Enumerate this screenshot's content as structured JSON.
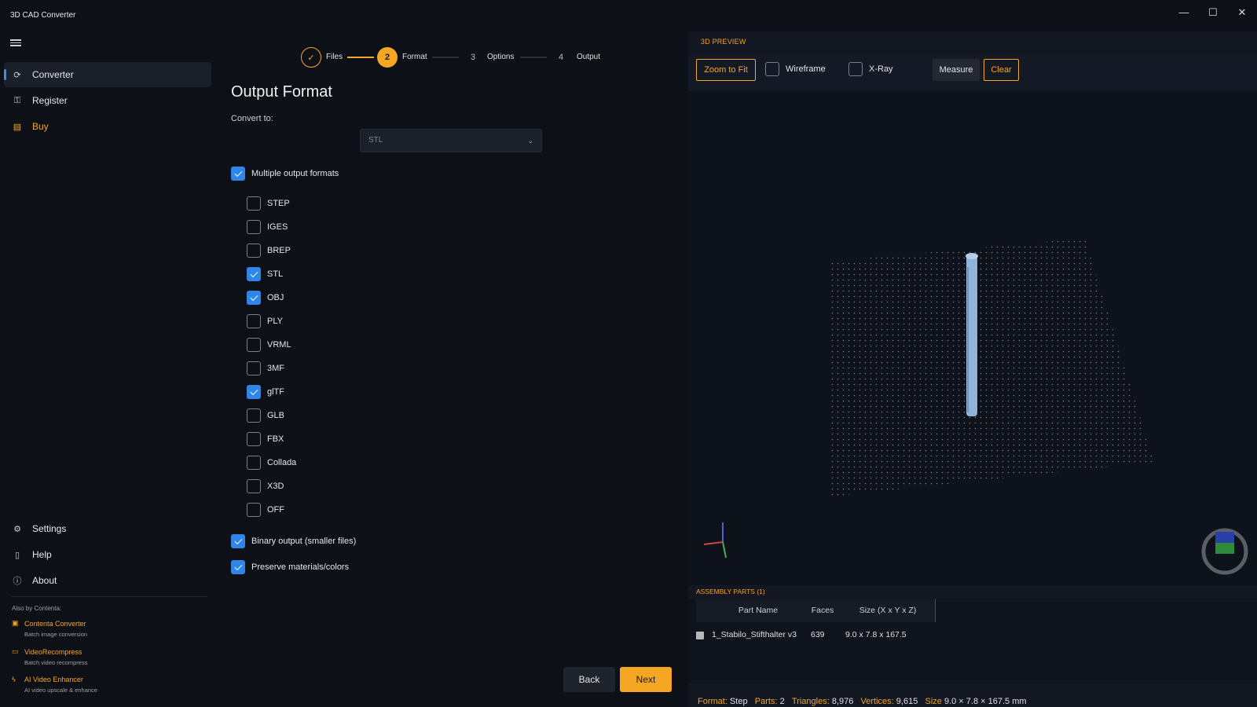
{
  "app": {
    "title": "3D CAD Converter"
  },
  "window_controls": {
    "minimize": "—",
    "maximize": "☐",
    "close": "✕"
  },
  "sidebar": {
    "items": [
      {
        "label": "Converter",
        "icon": "refresh-icon"
      },
      {
        "label": "Register",
        "icon": "key-icon"
      },
      {
        "label": "Buy",
        "icon": "bag-icon"
      }
    ],
    "bottom_items": [
      {
        "label": "Settings",
        "icon": "gear-icon"
      },
      {
        "label": "Help",
        "icon": "book-icon"
      },
      {
        "label": "About",
        "icon": "info-icon"
      }
    ],
    "also_by_label": "Also by Contenta:",
    "also_by": [
      {
        "title": "Contenta Converter",
        "subtitle": "Batch image conversion",
        "icon": "image-icon"
      },
      {
        "title": "VideoRecompress",
        "subtitle": "Batch video recompress",
        "icon": "video-icon"
      },
      {
        "title": "AI Video Enhancer",
        "subtitle": "AI video upscale & enhance",
        "icon": "bolt-icon"
      }
    ]
  },
  "stepper": {
    "steps": [
      {
        "num": "✓",
        "label": "Files",
        "state": "done"
      },
      {
        "num": "2",
        "label": "Format",
        "state": "active"
      },
      {
        "num": "3",
        "label": "Options",
        "state": "idle"
      },
      {
        "num": "4",
        "label": "Output",
        "state": "idle"
      }
    ]
  },
  "main": {
    "title": "Output Format",
    "convert_label": "Convert to:",
    "convert_value": "STL",
    "multiple_label": "Multiple output formats",
    "multiple_checked": true,
    "formats": [
      {
        "label": "STEP",
        "checked": false
      },
      {
        "label": "IGES",
        "checked": false
      },
      {
        "label": "BREP",
        "checked": false
      },
      {
        "label": "STL",
        "checked": true
      },
      {
        "label": "OBJ",
        "checked": true
      },
      {
        "label": "PLY",
        "checked": false
      },
      {
        "label": "VRML",
        "checked": false
      },
      {
        "label": "3MF",
        "checked": false
      },
      {
        "label": "glTF",
        "checked": true
      },
      {
        "label": "GLB",
        "checked": false
      },
      {
        "label": "FBX",
        "checked": false
      },
      {
        "label": "Collada",
        "checked": false
      },
      {
        "label": "X3D",
        "checked": false
      },
      {
        "label": "OFF",
        "checked": false
      }
    ],
    "binary_label": "Binary output (smaller files)",
    "preserve_label": "Preserve materials/colors",
    "back_label": "Back",
    "next_label": "Next"
  },
  "preview": {
    "header": "3D PREVIEW",
    "zoom_label": "Zoom to Fit",
    "wireframe_label": "Wireframe",
    "xray_label": "X-Ray",
    "measure_label": "Measure",
    "clear_label": "Clear",
    "parts_header": "ASSEMBLY PARTS  (1)",
    "columns": [
      "Part Name",
      "Faces",
      "Size (X x Y x Z)"
    ],
    "row": {
      "name": "1_Stabilo_Stifthalter v3",
      "faces": "639",
      "size": "9.0  x  7.8  x  167.5"
    },
    "status": {
      "format_k": "Format:",
      "format_v": "Step",
      "parts_k": "Parts:",
      "parts_v": "2",
      "tri_k": "Triangles:",
      "tri_v": "8,976",
      "vert_k": "Vertices:",
      "vert_v": "9,615",
      "size_k": "Size",
      "size_v": "9.0 × 7.8 × 167.5 mm"
    },
    "colors": {
      "accent": "#f5a623",
      "model": "#8fb3d9"
    }
  }
}
